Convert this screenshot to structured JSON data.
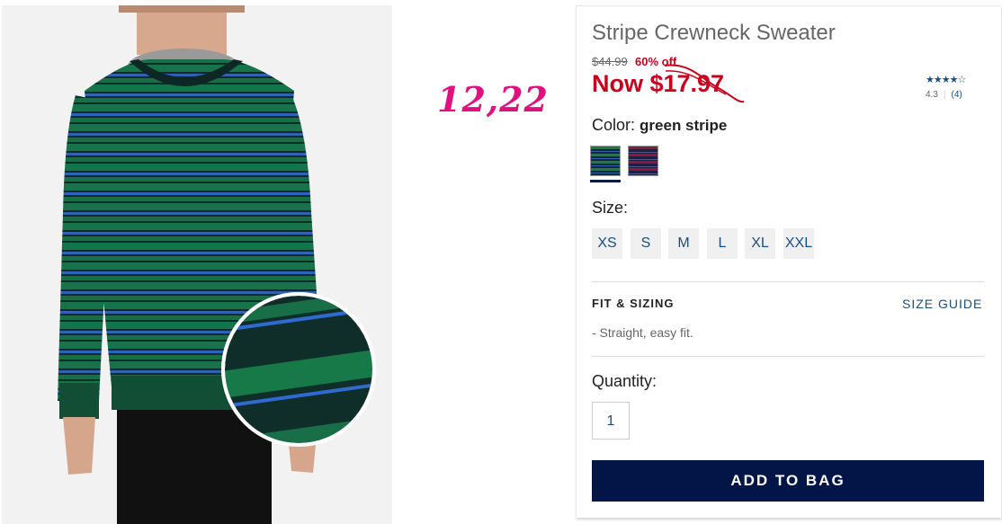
{
  "handwritten_note": "12,22",
  "product": {
    "title": "Stripe Crewneck Sweater",
    "original_price": "$44.99",
    "percent_off": "60% off",
    "now_price": "Now $17.97",
    "rating_stars": "★★★★☆",
    "rating_value": "4.3",
    "review_count": "(4)"
  },
  "color": {
    "label": "Color:",
    "selected": "green stripe",
    "swatches": [
      "green stripe",
      "red stripe"
    ]
  },
  "size": {
    "label": "Size:",
    "options": [
      "XS",
      "S",
      "M",
      "L",
      "XL",
      "XXL"
    ]
  },
  "fit": {
    "heading": "FIT & SIZING",
    "size_guide": "SIZE GUIDE",
    "description": "- Straight, easy fit."
  },
  "quantity": {
    "label": "Quantity:",
    "value": "1"
  },
  "add_to_bag": "ADD TO BAG",
  "colors": {
    "sale_red": "#c8001e",
    "link_blue": "#1c4e80",
    "button_navy": "#031447",
    "annotation_pink": "#e0117f"
  }
}
